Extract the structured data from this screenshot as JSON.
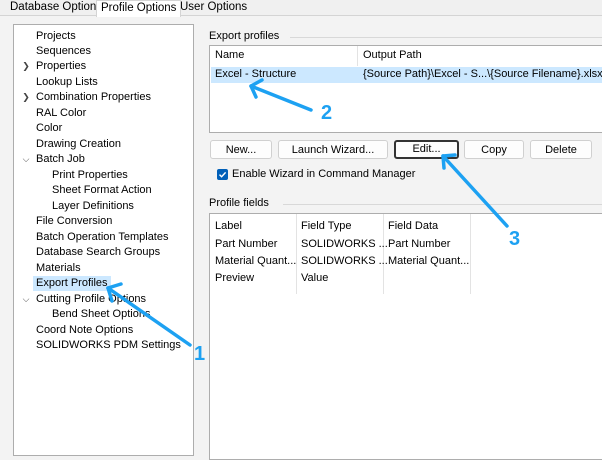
{
  "tabs": [
    "Database Options",
    "Profile Options",
    "User Options"
  ],
  "active_tab": 1,
  "sidebar": {
    "items": [
      {
        "label": "Projects"
      },
      {
        "label": "Sequences"
      },
      {
        "label": "Properties"
      },
      {
        "label": "Lookup Lists"
      },
      {
        "label": "Combination Properties"
      },
      {
        "label": "RAL Color"
      },
      {
        "label": "Color"
      },
      {
        "label": "Drawing Creation"
      },
      {
        "label": "Batch Job"
      },
      {
        "label": "Print Properties"
      },
      {
        "label": "Sheet Format Action"
      },
      {
        "label": "Layer Definitions"
      },
      {
        "label": "File Conversion"
      },
      {
        "label": "Batch Operation Templates"
      },
      {
        "label": "Database Search Groups"
      },
      {
        "label": "Materials"
      },
      {
        "label": "Export Profiles"
      },
      {
        "label": "Cutting Profile Options"
      },
      {
        "label": "Bend Sheet Options"
      },
      {
        "label": "Coord Note Options"
      },
      {
        "label": "SOLIDWORKS PDM Settings"
      }
    ],
    "selected": "Export Profiles"
  },
  "export_profiles": {
    "group_label": "Export profiles",
    "columns": [
      "Name",
      "Output Path"
    ],
    "rows": [
      {
        "name": "Excel - Structure",
        "output_path": "{Source Path}\\Excel - S...\\{Source Filename}.xlsx"
      }
    ]
  },
  "buttons": {
    "new": "New...",
    "launch_wizard": "Launch Wizard...",
    "edit": "Edit...",
    "copy": "Copy",
    "delete": "Delete"
  },
  "wizard_checkbox": {
    "label": "Enable Wizard in Command Manager",
    "checked": true
  },
  "profile_fields": {
    "group_label": "Profile fields",
    "columns": [
      "Label",
      "Field Type",
      "Field Data"
    ],
    "rows": [
      {
        "label": "Part Number",
        "field_type": "SOLIDWORKS ...",
        "field_data": "Part Number"
      },
      {
        "label": "Material Quant...",
        "field_type": "SOLIDWORKS ...",
        "field_data": "Material Quant..."
      },
      {
        "label": "Preview",
        "field_type": "Value",
        "field_data": ""
      }
    ]
  },
  "annotations": {
    "one": "1",
    "two": "2",
    "three": "3"
  },
  "colors": {
    "selection": "#cce8ff",
    "accent": "#005fb8",
    "annotation": "#1da1f2"
  }
}
